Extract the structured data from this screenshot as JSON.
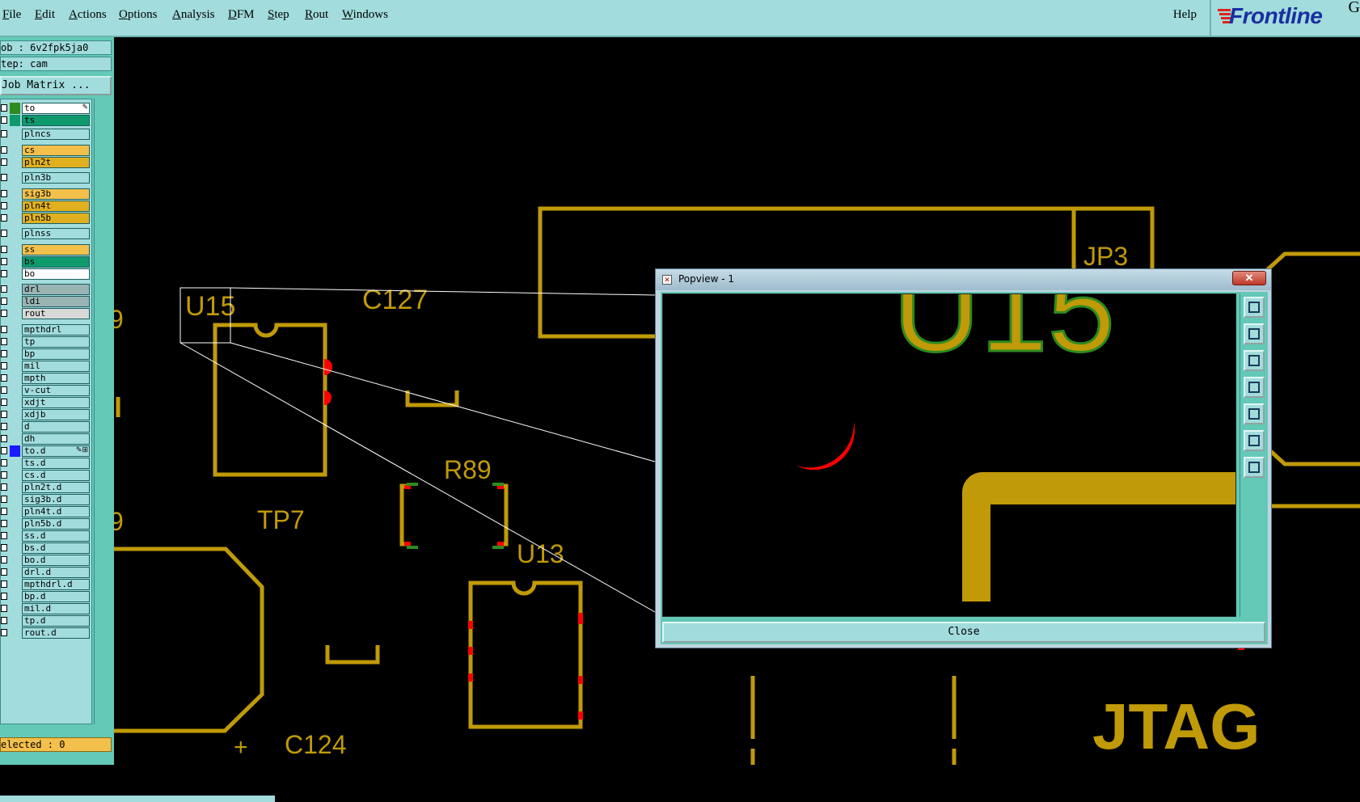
{
  "menubar": {
    "items": [
      "File",
      "Edit",
      "Actions",
      "Options",
      "Analysis",
      "DFM",
      "Step",
      "Rout",
      "Windows"
    ],
    "help": "Help",
    "logo": "Frontline",
    "logo_suffix": "G"
  },
  "leftpanel": {
    "job": "ob : 6v2fpk5ja0",
    "step": "tep: cam",
    "job_matrix": "Job Matrix ...",
    "selected": "elected : 0",
    "layers": [
      {
        "name": "to",
        "color": "#ffffff",
        "swatch": "#2e8b20",
        "marker": "✎"
      },
      {
        "name": "ts",
        "color": "#0f9a6e",
        "swatch": "#0f9a6e",
        "marker": ""
      },
      {
        "name": "plncs",
        "color": "#a2dcdc",
        "swatch": "",
        "marker": ""
      },
      {
        "name": "cs",
        "color": "#f3c04c",
        "swatch": "",
        "marker": ""
      },
      {
        "name": "pln2t",
        "color": "#e0b020",
        "swatch": "",
        "marker": ""
      },
      {
        "name": "pln3b",
        "color": "#a2dcdc",
        "swatch": "",
        "marker": ""
      },
      {
        "name": "sig3b",
        "color": "#f3c04c",
        "swatch": "",
        "marker": ""
      },
      {
        "name": "pln4t",
        "color": "#e0b020",
        "swatch": "",
        "marker": ""
      },
      {
        "name": "pln5b",
        "color": "#e0b020",
        "swatch": "",
        "marker": ""
      },
      {
        "name": "plnss",
        "color": "#a2dcdc",
        "swatch": "",
        "marker": ""
      },
      {
        "name": "ss",
        "color": "#f3c04c",
        "swatch": "",
        "marker": ""
      },
      {
        "name": "bs",
        "color": "#0f9a6e",
        "swatch": "",
        "marker": ""
      },
      {
        "name": "bo",
        "color": "#ffffff",
        "swatch": "",
        "marker": ""
      },
      {
        "name": "drl",
        "color": "#9ab4b4",
        "swatch": "",
        "marker": ""
      },
      {
        "name": "ldi",
        "color": "#9ab4b4",
        "swatch": "",
        "marker": ""
      },
      {
        "name": "rout",
        "color": "#d8d8d8",
        "swatch": "",
        "marker": ""
      },
      {
        "name": "mpthdrl",
        "color": "#a2dcdc",
        "swatch": "",
        "marker": ""
      },
      {
        "name": "tp",
        "color": "#a2dcdc",
        "swatch": "",
        "marker": ""
      },
      {
        "name": "bp",
        "color": "#a2dcdc",
        "swatch": "",
        "marker": ""
      },
      {
        "name": "mil",
        "color": "#a2dcdc",
        "swatch": "",
        "marker": ""
      },
      {
        "name": "mpth",
        "color": "#a2dcdc",
        "swatch": "",
        "marker": ""
      },
      {
        "name": "v-cut",
        "color": "#a2dcdc",
        "swatch": "",
        "marker": ""
      },
      {
        "name": "xdjt",
        "color": "#a2dcdc",
        "swatch": "",
        "marker": ""
      },
      {
        "name": "xdjb",
        "color": "#a2dcdc",
        "swatch": "",
        "marker": ""
      },
      {
        "name": "d",
        "color": "#a2dcdc",
        "swatch": "",
        "marker": ""
      },
      {
        "name": "dh",
        "color": "#a2dcdc",
        "swatch": "",
        "marker": ""
      },
      {
        "name": "to.d",
        "color": "#a2dcdc",
        "swatch": "#1a1aff",
        "marker": "✎⊞"
      },
      {
        "name": "ts.d",
        "color": "#a2dcdc",
        "swatch": "",
        "marker": ""
      },
      {
        "name": "cs.d",
        "color": "#a2dcdc",
        "swatch": "",
        "marker": ""
      },
      {
        "name": "pln2t.d",
        "color": "#a2dcdc",
        "swatch": "",
        "marker": ""
      },
      {
        "name": "sig3b.d",
        "color": "#a2dcdc",
        "swatch": "",
        "marker": ""
      },
      {
        "name": "pln4t.d",
        "color": "#a2dcdc",
        "swatch": "",
        "marker": ""
      },
      {
        "name": "pln5b.d",
        "color": "#a2dcdc",
        "swatch": "",
        "marker": ""
      },
      {
        "name": "ss.d",
        "color": "#a2dcdc",
        "swatch": "",
        "marker": ""
      },
      {
        "name": "bs.d",
        "color": "#a2dcdc",
        "swatch": "",
        "marker": ""
      },
      {
        "name": "bo.d",
        "color": "#a2dcdc",
        "swatch": "",
        "marker": ""
      },
      {
        "name": "drl.d",
        "color": "#a2dcdc",
        "swatch": "",
        "marker": ""
      },
      {
        "name": "mpthdrl.d",
        "color": "#a2dcdc",
        "swatch": "",
        "marker": ""
      },
      {
        "name": "bp.d",
        "color": "#a2dcdc",
        "swatch": "",
        "marker": ""
      },
      {
        "name": "mil.d",
        "color": "#a2dcdc",
        "swatch": "",
        "marker": ""
      },
      {
        "name": "tp.d",
        "color": "#a2dcdc",
        "swatch": "",
        "marker": ""
      },
      {
        "name": "rout.d",
        "color": "#a2dcdc",
        "swatch": "",
        "marker": ""
      }
    ]
  },
  "canvas": {
    "labels": {
      "u15": "U15",
      "c127": "C127",
      "jp3": "JP3",
      "r89": "R89",
      "tp7": "TP7",
      "u13": "U13",
      "c124": "C124",
      "jtag": "JTAG",
      "left9a": "9",
      "left9b": "9",
      "plus1": "+",
      "plus2": "+"
    },
    "colors": {
      "copper": "#c09a08",
      "pad_edge": "#2e8b20",
      "marker": "#ff0000",
      "background": "#000000"
    }
  },
  "popview": {
    "title": "Popview - 1",
    "close_x": "✕",
    "close_button": "Close",
    "zoom_label": "U15",
    "tools": [
      "zoom-home-icon",
      "zoom-in-icon",
      "zoom-out-icon",
      "pan-left-icon",
      "pan-right-icon",
      "zoom-fit-icon",
      "zoom-area-icon"
    ]
  }
}
